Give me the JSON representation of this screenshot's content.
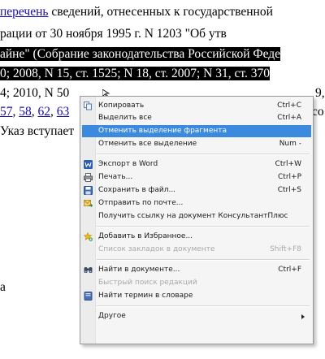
{
  "document": {
    "line1": {
      "link": "перечень",
      "text": " сведений, отнесенных к государственной"
    },
    "line2": {
      "text": "рации от 30 ноября 1995 г. N 1203 \"Об утв"
    },
    "line3": {
      "text": "айне\" (Собрание законодательства Российской Феде"
    },
    "line4": {
      "text": "0; 2008, N 15, ст. 1525; N 18, ст. 2007; N 31, ст. 370"
    },
    "line5": {
      "text": "4; 2010, N 50",
      "right": "9,"
    },
    "line6": {
      "links": [
        "57",
        "58",
        "62",
        "63"
      ],
      "right": "со"
    },
    "line7": {
      "text": "Указ вступает"
    },
    "stray_letter": "а"
  },
  "context_menu": {
    "items": [
      {
        "label": "Копировать",
        "shortcut": "Ctrl+C",
        "icon": "copy-icon"
      },
      {
        "label": "Выделить все",
        "shortcut": "Ctrl+A"
      },
      {
        "label": "Отменить выделение фрагмента",
        "shortcut": ""
      },
      {
        "label": "Отменить все выделение",
        "shortcut": "Num -"
      },
      {
        "label": "Экспорт в Word",
        "shortcut": "Ctrl+W",
        "icon": "word-icon"
      },
      {
        "label": "Печать...",
        "shortcut": "Ctrl+P",
        "icon": "printer-icon"
      },
      {
        "label": "Сохранить в файл...",
        "shortcut": "Ctrl+S",
        "icon": "save-icon"
      },
      {
        "label": "Отправить по почте...",
        "shortcut": "",
        "icon": "mail-icon"
      },
      {
        "label": "Получить ссылку на документ КонсультантПлюс",
        "shortcut": ""
      },
      {
        "label": "Добавить в Избранное...",
        "shortcut": "",
        "icon": "star-add-icon"
      },
      {
        "label": "Список закладок в документе",
        "shortcut": "Shift+F8"
      },
      {
        "label": "Найти в документе...",
        "shortcut": "Ctrl+F",
        "icon": "binoculars-icon"
      },
      {
        "label": "Быстрый поиск редакций",
        "shortcut": ""
      },
      {
        "label": "Найти термин в словаре",
        "shortcut": "",
        "icon": "dictionary-icon"
      },
      {
        "label": "Другое",
        "shortcut": ""
      }
    ],
    "highlight_color": "#3c8ade"
  }
}
